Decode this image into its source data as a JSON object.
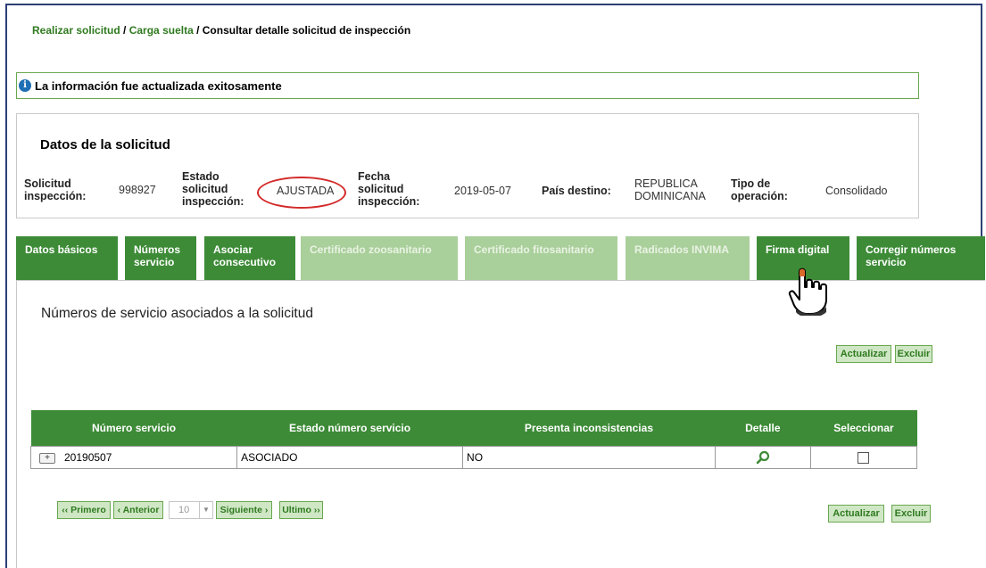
{
  "breadcrumb": {
    "item1": "Realizar solicitud",
    "sep": " / ",
    "item2": "Carga suelta",
    "current": "Consultar detalle solicitud de inspección"
  },
  "message": {
    "text": "La información fue actualizada exitosamente"
  },
  "datos": {
    "title": "Datos de la solicitud",
    "solicitud_label": "Solicitud inspección:",
    "solicitud_value": "998927",
    "estado_label": "Estado solicitud inspección:",
    "estado_value": "AJUSTADA",
    "fecha_label": "Fecha solicitud inspección:",
    "fecha_value": "2019-05-07",
    "pais_label": "País destino:",
    "pais_value": "REPUBLICA DOMINICANA",
    "tipo_label": "Tipo de operación:",
    "tipo_value": "Consolidado"
  },
  "tabs": [
    {
      "label": "Datos básicos",
      "enabled": true
    },
    {
      "label": "Números servicio",
      "enabled": true
    },
    {
      "label": "Asociar consecutivo",
      "enabled": true
    },
    {
      "label": "Certificado zoosanitario",
      "enabled": false
    },
    {
      "label": "Certificado fitosanitario",
      "enabled": false
    },
    {
      "label": "Radicados INVIMA",
      "enabled": false
    },
    {
      "label": "Firma digital",
      "enabled": true
    },
    {
      "label": "Corregir números servicio",
      "enabled": true
    }
  ],
  "panel": {
    "title": "Números de servicio asociados a la solicitud",
    "actualizar": "Actualizar",
    "excluir": "Excluir"
  },
  "table": {
    "headers": [
      "Número servicio",
      "Estado número servicio",
      "Presenta inconsistencias",
      "Detalle",
      "Seleccionar"
    ],
    "rows": [
      {
        "numero": "20190507",
        "estado": "ASOCIADO",
        "inconsistencias": "NO"
      }
    ]
  },
  "pager": {
    "first": "‹‹ Primero",
    "prev": "‹ Anterior",
    "page_size": "10",
    "next": "Siguiente ›",
    "last": "Ultimo ››"
  },
  "colors": {
    "primary_green": "#3d8b37",
    "disabled_green": "#a9cf9a",
    "highlight_red": "#d32a2a"
  }
}
